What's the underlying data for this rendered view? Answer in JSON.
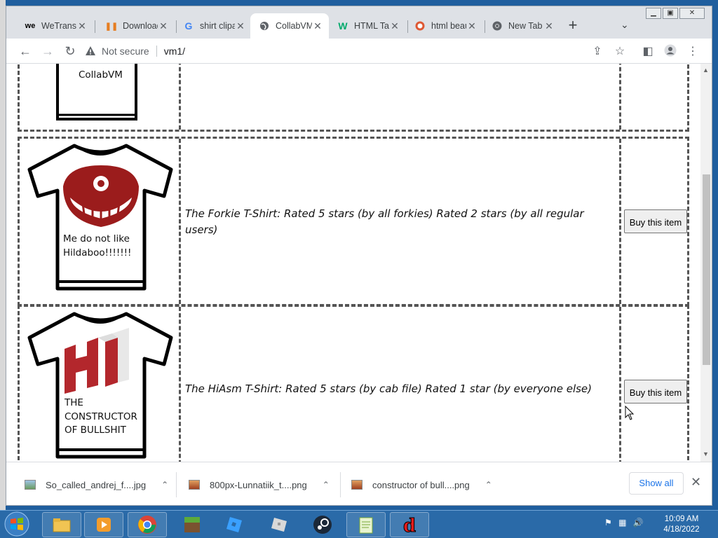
{
  "browser": {
    "tabs": [
      {
        "title": "WeTransfer",
        "icon": "wetransfer-icon"
      },
      {
        "title": "Downloads",
        "icon": "download-icon"
      },
      {
        "title": "shirt clipart",
        "icon": "google-icon"
      },
      {
        "title": "CollabVM",
        "icon": "globe-icon"
      },
      {
        "title": "HTML Tables",
        "icon": "w3schools-icon"
      },
      {
        "title": "html beautifier",
        "icon": "duckduckgo-icon"
      },
      {
        "title": "New Tab",
        "icon": "chrome-icon"
      }
    ],
    "address": {
      "security_label": "Not secure",
      "url": "vm1/"
    }
  },
  "page": {
    "rows": [
      {
        "shirt_text": "CollabVM"
      },
      {
        "shirt_text": "Me do not like Hildaboo!!!!!!!",
        "description": "The Forkie T-Shirt: Rated 5 stars (by all forkies) Rated 2 stars (by all regular users)",
        "button": "Buy this item"
      },
      {
        "shirt_text": "THE CONSTRUCTOR OF BULLSHIT",
        "description": "The HiAsm T-Shirt: Rated 5 stars (by cab file) Rated 1 star (by everyone else)",
        "button": "Buy this item"
      }
    ]
  },
  "downloads": {
    "items": [
      {
        "name": "So_called_andrej_f....jpg"
      },
      {
        "name": "800px-Lunnatiik_t....png"
      },
      {
        "name": "constructor of bull....png"
      }
    ],
    "show_all": "Show all"
  },
  "taskbar": {
    "time": "10:09 AM",
    "date": "4/18/2022"
  },
  "colors": {
    "forkie_logo": "#9b1c1c",
    "hiasm_logo": "#b3272c",
    "accent_link": "#1a73e8",
    "taskbar": "#2a6aa8"
  }
}
